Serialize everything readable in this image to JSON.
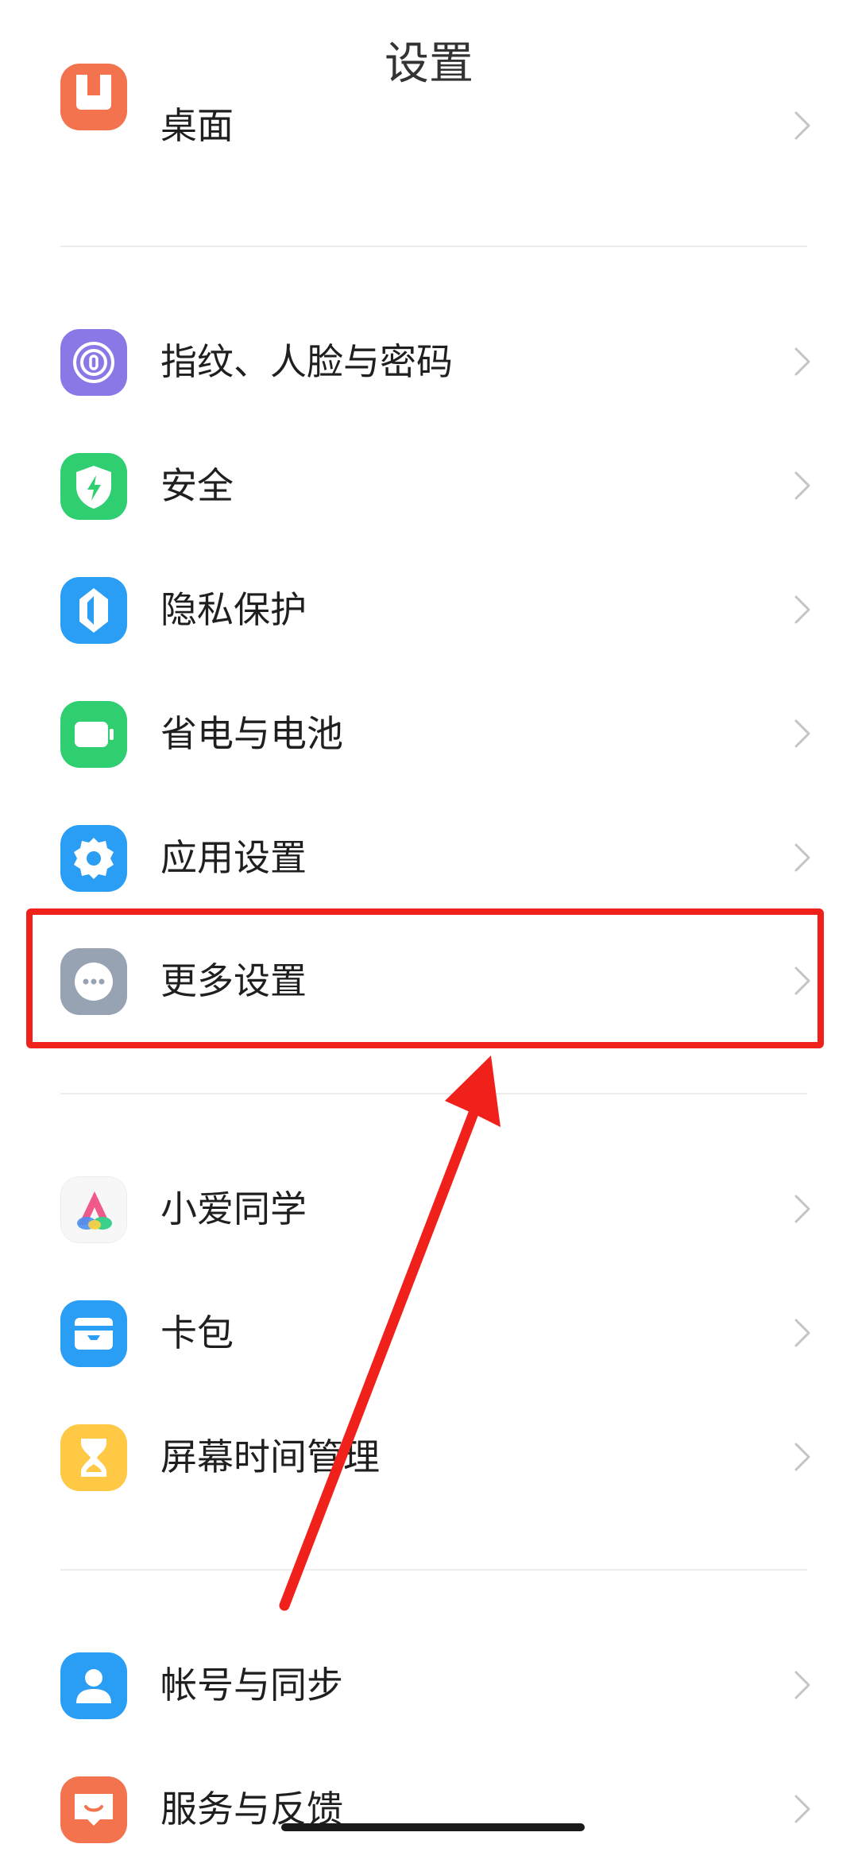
{
  "header": {
    "title": "设置"
  },
  "items": {
    "desktop": {
      "label": "桌面",
      "icon": "home-screen-icon",
      "color": "#f2734d"
    },
    "biometric": {
      "label": "指纹、人脸与密码",
      "icon": "fingerprint-icon",
      "color": "#8a78e6"
    },
    "security": {
      "label": "安全",
      "icon": "shield-lightning-icon",
      "color": "#2fce70"
    },
    "privacy": {
      "label": "隐私保护",
      "icon": "privacy-icon",
      "color": "#2a9df4"
    },
    "battery": {
      "label": "省电与电池",
      "icon": "battery-icon",
      "color": "#2fce70"
    },
    "apps": {
      "label": "应用设置",
      "icon": "gear-icon",
      "color": "#2a9df4"
    },
    "more": {
      "label": "更多设置",
      "icon": "more-dots-icon",
      "color": "#97a3b3"
    },
    "xiaoai": {
      "label": "小爱同学",
      "icon": "xiaoai-icon",
      "color": "#f5f5f5"
    },
    "wallet": {
      "label": "卡包",
      "icon": "wallet-card-icon",
      "color": "#2a9df4"
    },
    "screentime": {
      "label": "屏幕时间管理",
      "icon": "hourglass-icon",
      "color": "#ffc845"
    },
    "account": {
      "label": "帐号与同步",
      "icon": "user-icon",
      "color": "#2a9df4"
    },
    "feedback": {
      "label": "服务与反馈",
      "icon": "feedback-icon",
      "color": "#f2734d"
    }
  },
  "annotation": {
    "highlight_color": "#f0211b"
  }
}
